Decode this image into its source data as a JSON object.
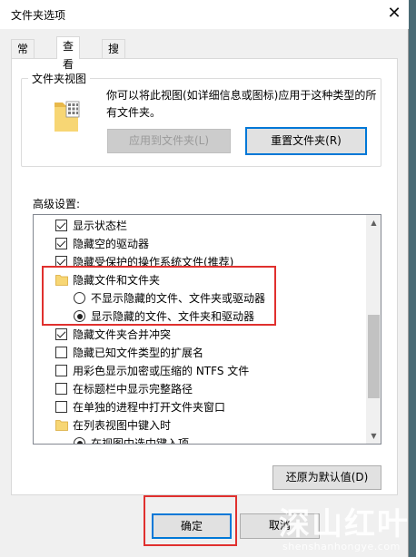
{
  "window": {
    "title": "文件夹选项",
    "close_glyph": "✕"
  },
  "tabs": [
    {
      "label": "常规",
      "active": false
    },
    {
      "label": "查看",
      "active": true
    },
    {
      "label": "搜索",
      "active": false
    }
  ],
  "folder_views": {
    "legend": "文件夹视图",
    "description": "你可以将此视图(如详细信息或图标)应用于这种类型的所有文件夹。",
    "apply_button": "应用到文件夹(L)",
    "reset_button": "重置文件夹(R)"
  },
  "advanced": {
    "label": "高级设置:",
    "items": [
      {
        "kind": "checkbox",
        "label": "显示状态栏",
        "checked": true,
        "indent": 1
      },
      {
        "kind": "checkbox",
        "label": "隐藏空的驱动器",
        "checked": true,
        "indent": 1
      },
      {
        "kind": "checkbox",
        "label": "隐藏受保护的操作系统文件(推荐)",
        "checked": true,
        "indent": 1
      },
      {
        "kind": "folder",
        "label": "隐藏文件和文件夹",
        "indent": 1
      },
      {
        "kind": "radio",
        "label": "不显示隐藏的文件、文件夹或驱动器",
        "checked": false,
        "indent": 2
      },
      {
        "kind": "radio",
        "label": "显示隐藏的文件、文件夹和驱动器",
        "checked": true,
        "indent": 2
      },
      {
        "kind": "checkbox",
        "label": "隐藏文件夹合并冲突",
        "checked": true,
        "indent": 1
      },
      {
        "kind": "checkbox",
        "label": "隐藏已知文件类型的扩展名",
        "checked": false,
        "indent": 1
      },
      {
        "kind": "checkbox",
        "label": "用彩色显示加密或压缩的 NTFS 文件",
        "checked": false,
        "indent": 1
      },
      {
        "kind": "checkbox",
        "label": "在标题栏中显示完整路径",
        "checked": false,
        "indent": 1
      },
      {
        "kind": "checkbox",
        "label": "在单独的进程中打开文件夹窗口",
        "checked": false,
        "indent": 1
      },
      {
        "kind": "folder",
        "label": "在列表视图中键入时",
        "indent": 1
      },
      {
        "kind": "radio",
        "label": "在视图中选中键入项",
        "checked": true,
        "indent": 2
      }
    ]
  },
  "restore_button": "还原为默认值(D)",
  "ok_button": "确定",
  "cancel_button": "取消",
  "watermark": {
    "big": "深山红叶",
    "small": "shenshanhongye.com"
  },
  "colors": {
    "highlight": "#e0302e",
    "default_button_border": "#0078d7",
    "folder": "#f7d674"
  }
}
